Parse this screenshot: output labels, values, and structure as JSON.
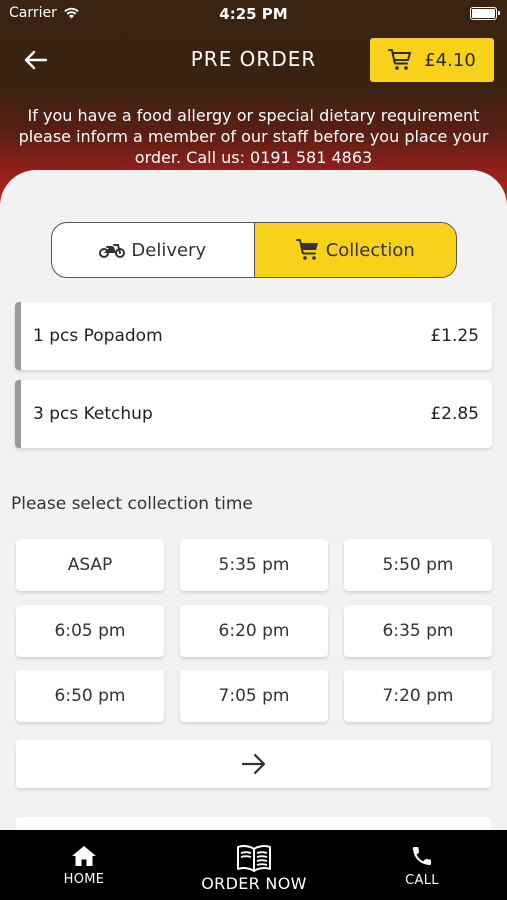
{
  "status_bar": {
    "carrier": "Carrier",
    "time": "4:25 PM"
  },
  "header": {
    "title": "PRE ORDER",
    "cart_total": "£4.10",
    "allergy_notice": "If you have a food allergy or special dietary requirement please inform a member of our staff before you place your order. Call us: 0191 581 4863"
  },
  "order_type": {
    "options": [
      "Delivery",
      "Collection"
    ],
    "selected": "Collection"
  },
  "cart_items": [
    {
      "name": "1 pcs Popadom",
      "price": "£1.25"
    },
    {
      "name": "3 pcs Ketchup",
      "price": "£2.85"
    }
  ],
  "collection": {
    "label": "Please select collection time",
    "slots": [
      "ASAP",
      "5:35 pm",
      "5:50 pm",
      "6:05 pm",
      "6:20 pm",
      "6:35 pm",
      "6:50 pm",
      "7:05 pm",
      "7:20 pm"
    ]
  },
  "bottom_nav": {
    "home": "HOME",
    "order_now": "ORDER NOW",
    "call": "CALL"
  },
  "colors": {
    "accent": "#f8d21a",
    "header_dark": "#3b2312",
    "header_red": "#c42b24",
    "nav_bg": "#000000"
  }
}
